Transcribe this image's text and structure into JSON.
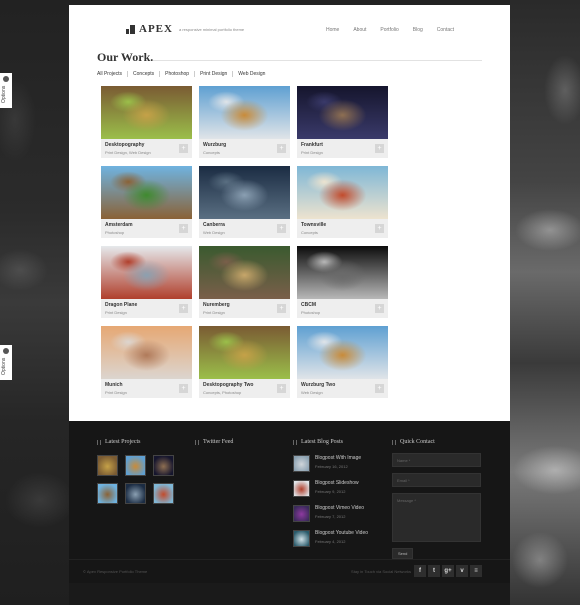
{
  "site": {
    "logo": "APEX",
    "tagline": "a responsive minimal portfolio theme"
  },
  "nav": [
    {
      "label": "Home"
    },
    {
      "label": "About"
    },
    {
      "label": "Portfolio"
    },
    {
      "label": "Blog"
    },
    {
      "label": "Contact"
    }
  ],
  "options_tab": {
    "label": "Options"
  },
  "work": {
    "title": "Our Work.",
    "filters": [
      {
        "label": "All Projects"
      },
      {
        "label": "Concepts"
      },
      {
        "label": "Photoshop"
      },
      {
        "label": "Print Design"
      },
      {
        "label": "Web Design"
      }
    ],
    "items": [
      {
        "title": "Desktopography",
        "cats": "Print Design, Web Design",
        "colors": [
          "#7a5b33",
          "#c5a148",
          "#9bbf4a"
        ]
      },
      {
        "title": "Wurzburg",
        "cats": "Concepts",
        "colors": [
          "#5fa0d2",
          "#c98b39",
          "#e0e4e8"
        ]
      },
      {
        "title": "Frankfurt",
        "cats": "Print Design",
        "colors": [
          "#15152d",
          "#8e6f52",
          "#3a3a6a"
        ]
      },
      {
        "title": "Amsterdam",
        "cats": "Photoshop",
        "colors": [
          "#6fb3e0",
          "#3f8a2f",
          "#8a6236"
        ]
      },
      {
        "title": "Canberra",
        "cats": "Web Design",
        "colors": [
          "#1b2c43",
          "#8a9fb2",
          "#5a6f82"
        ]
      },
      {
        "title": "Townsville",
        "cats": "Concepts",
        "colors": [
          "#7fb7d6",
          "#c24b2c",
          "#ede3cf"
        ]
      },
      {
        "title": "Dragon Plane",
        "cats": "Print Design",
        "colors": [
          "#e6e9ec",
          "#8ca0b0",
          "#b03f2c"
        ]
      },
      {
        "title": "Nuremberg",
        "cats": "Print Design",
        "colors": [
          "#3a5a2f",
          "#c7a66a",
          "#7a5f4a"
        ]
      },
      {
        "title": "CBCM",
        "cats": "Photoshop",
        "colors": [
          "#0c0c0c",
          "#6a6a6a",
          "#b8b8b8"
        ]
      },
      {
        "title": "Munich",
        "cats": "Print Design",
        "colors": [
          "#e6a874",
          "#b07a5a",
          "#dcd5cf"
        ]
      },
      {
        "title": "Desktopography Two",
        "cats": "Concepts, Photoshop",
        "colors": [
          "#7a5b33",
          "#c5a148",
          "#9bbf4a"
        ]
      },
      {
        "title": "Wurzburg Two",
        "cats": "Web Design",
        "colors": [
          "#5fa0d2",
          "#c98b39",
          "#e0e4e8"
        ]
      }
    ],
    "plus_glyph": "+"
  },
  "footer": {
    "latest_projects": {
      "title": "Latest Projects",
      "thumbs": [
        {
          "colors": [
            "#7a5b33",
            "#c5a148"
          ]
        },
        {
          "colors": [
            "#5fa0d2",
            "#c98b39"
          ]
        },
        {
          "colors": [
            "#15152d",
            "#8e6f52"
          ]
        },
        {
          "colors": [
            "#6fb3e0",
            "#8a6236"
          ]
        },
        {
          "colors": [
            "#1b2c43",
            "#8a9fb2"
          ]
        },
        {
          "colors": [
            "#7fb7d6",
            "#c24b2c"
          ]
        }
      ]
    },
    "twitter": {
      "title": "Twitter Feed"
    },
    "blog": {
      "title": "Latest Blog Posts",
      "posts": [
        {
          "title": "Blogpost With Image",
          "date": "February 16, 2012",
          "colors": [
            "#8aa0b0",
            "#d0d5da"
          ]
        },
        {
          "title": "Blogpost Slideshow",
          "date": "February 9, 2012",
          "colors": [
            "#e0e4e8",
            "#b03f2c"
          ]
        },
        {
          "title": "Blogpost Vimeo Video",
          "date": "February 7, 2012",
          "colors": [
            "#3a2a5a",
            "#8e3aa0"
          ]
        },
        {
          "title": "Blogpost Youtube Video",
          "date": "February 4, 2012",
          "colors": [
            "#2a5a6a",
            "#d0e0e6"
          ]
        }
      ]
    },
    "contact": {
      "title": "Quick Contact",
      "name_placeholder": "Name *",
      "email_placeholder": "Email *",
      "message_placeholder": "Message *",
      "send_label": "Send"
    },
    "copyright": "© Apex Responsive Portfolio Theme",
    "stay_in_touch": "Stay in Touch via Social Networks",
    "socials": [
      {
        "name": "facebook",
        "glyph": "f"
      },
      {
        "name": "twitter",
        "glyph": "t"
      },
      {
        "name": "google-plus",
        "glyph": "g+"
      },
      {
        "name": "vimeo",
        "glyph": "v"
      },
      {
        "name": "rss",
        "glyph": "≡"
      }
    ]
  }
}
